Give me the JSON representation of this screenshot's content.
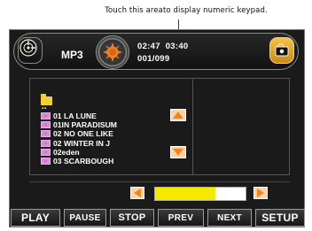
{
  "annotation": {
    "text": "Touch this areato display numeric keypad."
  },
  "header": {
    "mode": "MP3",
    "elapsed_time": "02:47",
    "total_time": "03:40",
    "track_counter": "001/099"
  },
  "file_browser": {
    "parent_folder": "..",
    "items": [
      "01 LA LUNE",
      "01IN PARADISUM",
      "02 NO ONE LIKE",
      "02 WINTER IN J",
      "02eden",
      "03 SCARBOUGH"
    ]
  },
  "seek_bar": {
    "progress_fraction": 0.67
  },
  "controls": {
    "play": "PLAY",
    "pause": "PAUSE",
    "stop": "STOP",
    "prev": "PREV",
    "next": "NEXT",
    "setup": "SETUP"
  },
  "colors": {
    "background": "#1a1a1a",
    "accent_orange": "#f58220",
    "seek_fill": "#f3ea00",
    "folder": "#f1cf38"
  },
  "icons": {
    "left_badge": "disc-mode-icon",
    "center": "disc-sun-icon",
    "right_badge": "folder-cap-icon",
    "list_up": "arrow-up-icon",
    "list_down": "arrow-down-icon",
    "seek_back": "arrow-left-icon",
    "seek_forward": "arrow-right-icon"
  }
}
